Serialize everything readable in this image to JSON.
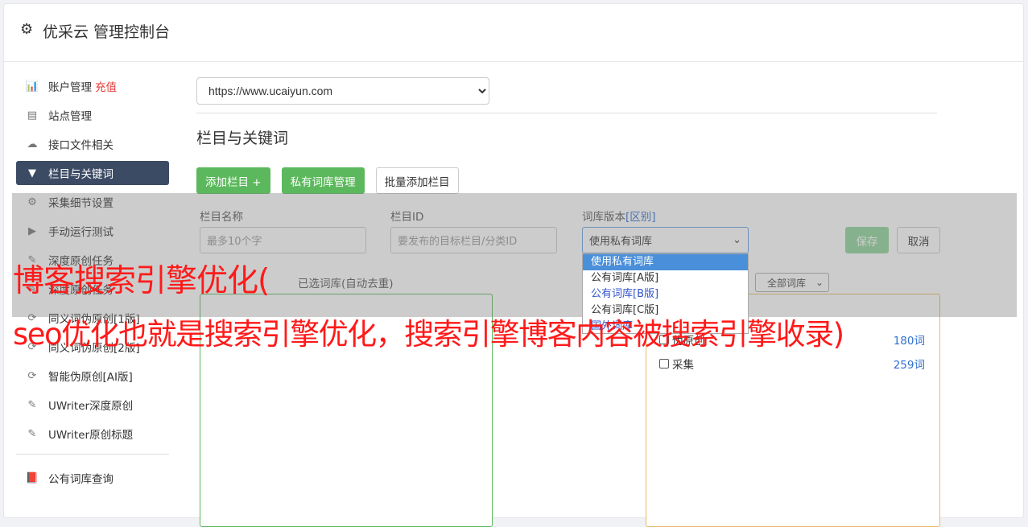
{
  "header": {
    "title": "优采云 管理控制台",
    "icon": "gear-icon"
  },
  "sidebar": {
    "items": [
      {
        "label": "账户管理",
        "extra": "充值",
        "icon": "bar-chart-icon"
      },
      {
        "label": "站点管理",
        "icon": "server-icon"
      },
      {
        "label": "接口文件相关",
        "icon": "cloud-upload-icon"
      },
      {
        "label": "栏目与关键词",
        "icon": "filter-icon",
        "active": true
      },
      {
        "label": "采集细节设置",
        "icon": "cogs-icon"
      },
      {
        "label": "手动运行测试",
        "icon": "play-circle-icon"
      },
      {
        "label": "深度原创任务",
        "icon": "edit-icon"
      },
      {
        "label": "深度原创任务",
        "icon": "edit-icon"
      },
      {
        "label": "同义词伪原创[1版]",
        "icon": "refresh-icon"
      },
      {
        "label": "同义词伪原创[2版]",
        "icon": "refresh-icon"
      },
      {
        "label": "智能伪原创[AI版]",
        "icon": "refresh-icon"
      },
      {
        "label": "UWriter深度原创",
        "icon": "edit-icon"
      },
      {
        "label": "UWriter原创标题",
        "icon": "edit-icon"
      }
    ],
    "bottom_item": {
      "label": "公有词库查询",
      "icon": "book-icon"
    }
  },
  "main": {
    "site_select": "https://www.ucaiyun.com",
    "section_title": "栏目与关键词",
    "buttons": {
      "add_column": "添加栏目 +",
      "private_lib": "私有词库管理",
      "batch_add": "批量添加栏目"
    },
    "form": {
      "name_label": "栏目名称",
      "name_placeholder": "最多10个字",
      "id_label": "栏目ID",
      "id_placeholder": "要发布的目标栏目/分类ID",
      "version_label": "词库版本",
      "version_diff": "[区别]",
      "version_value": "使用私有词库",
      "save": "保存",
      "cancel": "取消"
    },
    "dropdown_options": [
      "使用私有词库",
      "公有词库[A版]",
      "公有词库[B版]",
      "公有词库[C版]",
      "国外词库"
    ],
    "chosen_label": "已选词库(自动去重)",
    "lib_filter": "全部词库",
    "libraries": [
      {
        "name": "伪原创",
        "count": "180词"
      },
      {
        "name": "采集",
        "count": "259词"
      }
    ]
  },
  "watermark": {
    "line1": "博客搜索引擎优化(",
    "line2": "seo优化也就是搜索引擎优化，搜索引擎博客内容被搜索引擎收录)"
  },
  "colors": {
    "accent_green": "#5cb85c",
    "active_nav": "#3c4b64",
    "watermark": "#ff1a1a"
  }
}
